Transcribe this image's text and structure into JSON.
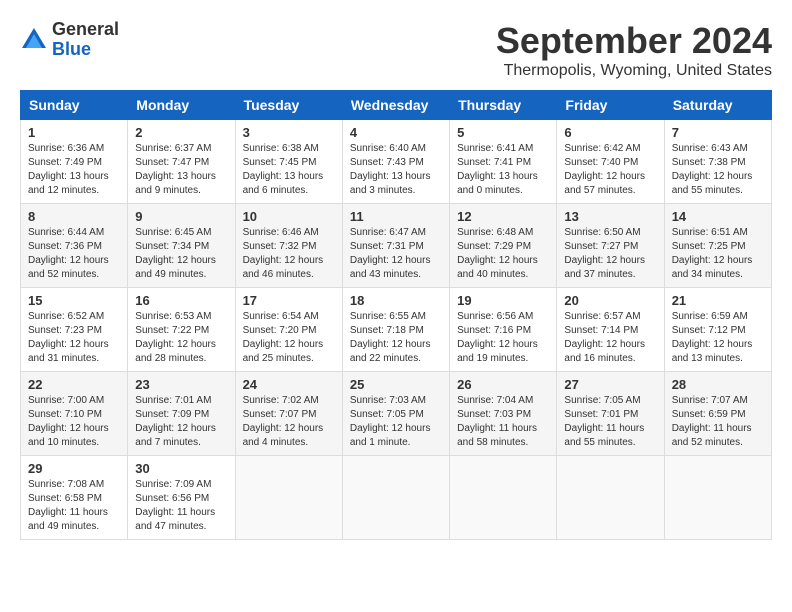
{
  "logo": {
    "general": "General",
    "blue": "Blue"
  },
  "title": "September 2024",
  "location": "Thermopolis, Wyoming, United States",
  "headers": [
    "Sunday",
    "Monday",
    "Tuesday",
    "Wednesday",
    "Thursday",
    "Friday",
    "Saturday"
  ],
  "weeks": [
    [
      {
        "day": "1",
        "info": "Sunrise: 6:36 AM\nSunset: 7:49 PM\nDaylight: 13 hours\nand 12 minutes."
      },
      {
        "day": "2",
        "info": "Sunrise: 6:37 AM\nSunset: 7:47 PM\nDaylight: 13 hours\nand 9 minutes."
      },
      {
        "day": "3",
        "info": "Sunrise: 6:38 AM\nSunset: 7:45 PM\nDaylight: 13 hours\nand 6 minutes."
      },
      {
        "day": "4",
        "info": "Sunrise: 6:40 AM\nSunset: 7:43 PM\nDaylight: 13 hours\nand 3 minutes."
      },
      {
        "day": "5",
        "info": "Sunrise: 6:41 AM\nSunset: 7:41 PM\nDaylight: 13 hours\nand 0 minutes."
      },
      {
        "day": "6",
        "info": "Sunrise: 6:42 AM\nSunset: 7:40 PM\nDaylight: 12 hours\nand 57 minutes."
      },
      {
        "day": "7",
        "info": "Sunrise: 6:43 AM\nSunset: 7:38 PM\nDaylight: 12 hours\nand 55 minutes."
      }
    ],
    [
      {
        "day": "8",
        "info": "Sunrise: 6:44 AM\nSunset: 7:36 PM\nDaylight: 12 hours\nand 52 minutes."
      },
      {
        "day": "9",
        "info": "Sunrise: 6:45 AM\nSunset: 7:34 PM\nDaylight: 12 hours\nand 49 minutes."
      },
      {
        "day": "10",
        "info": "Sunrise: 6:46 AM\nSunset: 7:32 PM\nDaylight: 12 hours\nand 46 minutes."
      },
      {
        "day": "11",
        "info": "Sunrise: 6:47 AM\nSunset: 7:31 PM\nDaylight: 12 hours\nand 43 minutes."
      },
      {
        "day": "12",
        "info": "Sunrise: 6:48 AM\nSunset: 7:29 PM\nDaylight: 12 hours\nand 40 minutes."
      },
      {
        "day": "13",
        "info": "Sunrise: 6:50 AM\nSunset: 7:27 PM\nDaylight: 12 hours\nand 37 minutes."
      },
      {
        "day": "14",
        "info": "Sunrise: 6:51 AM\nSunset: 7:25 PM\nDaylight: 12 hours\nand 34 minutes."
      }
    ],
    [
      {
        "day": "15",
        "info": "Sunrise: 6:52 AM\nSunset: 7:23 PM\nDaylight: 12 hours\nand 31 minutes."
      },
      {
        "day": "16",
        "info": "Sunrise: 6:53 AM\nSunset: 7:22 PM\nDaylight: 12 hours\nand 28 minutes."
      },
      {
        "day": "17",
        "info": "Sunrise: 6:54 AM\nSunset: 7:20 PM\nDaylight: 12 hours\nand 25 minutes."
      },
      {
        "day": "18",
        "info": "Sunrise: 6:55 AM\nSunset: 7:18 PM\nDaylight: 12 hours\nand 22 minutes."
      },
      {
        "day": "19",
        "info": "Sunrise: 6:56 AM\nSunset: 7:16 PM\nDaylight: 12 hours\nand 19 minutes."
      },
      {
        "day": "20",
        "info": "Sunrise: 6:57 AM\nSunset: 7:14 PM\nDaylight: 12 hours\nand 16 minutes."
      },
      {
        "day": "21",
        "info": "Sunrise: 6:59 AM\nSunset: 7:12 PM\nDaylight: 12 hours\nand 13 minutes."
      }
    ],
    [
      {
        "day": "22",
        "info": "Sunrise: 7:00 AM\nSunset: 7:10 PM\nDaylight: 12 hours\nand 10 minutes."
      },
      {
        "day": "23",
        "info": "Sunrise: 7:01 AM\nSunset: 7:09 PM\nDaylight: 12 hours\nand 7 minutes."
      },
      {
        "day": "24",
        "info": "Sunrise: 7:02 AM\nSunset: 7:07 PM\nDaylight: 12 hours\nand 4 minutes."
      },
      {
        "day": "25",
        "info": "Sunrise: 7:03 AM\nSunset: 7:05 PM\nDaylight: 12 hours\nand 1 minute."
      },
      {
        "day": "26",
        "info": "Sunrise: 7:04 AM\nSunset: 7:03 PM\nDaylight: 11 hours\nand 58 minutes."
      },
      {
        "day": "27",
        "info": "Sunrise: 7:05 AM\nSunset: 7:01 PM\nDaylight: 11 hours\nand 55 minutes."
      },
      {
        "day": "28",
        "info": "Sunrise: 7:07 AM\nSunset: 6:59 PM\nDaylight: 11 hours\nand 52 minutes."
      }
    ],
    [
      {
        "day": "29",
        "info": "Sunrise: 7:08 AM\nSunset: 6:58 PM\nDaylight: 11 hours\nand 49 minutes."
      },
      {
        "day": "30",
        "info": "Sunrise: 7:09 AM\nSunset: 6:56 PM\nDaylight: 11 hours\nand 47 minutes."
      },
      {
        "day": "",
        "info": ""
      },
      {
        "day": "",
        "info": ""
      },
      {
        "day": "",
        "info": ""
      },
      {
        "day": "",
        "info": ""
      },
      {
        "day": "",
        "info": ""
      }
    ]
  ]
}
